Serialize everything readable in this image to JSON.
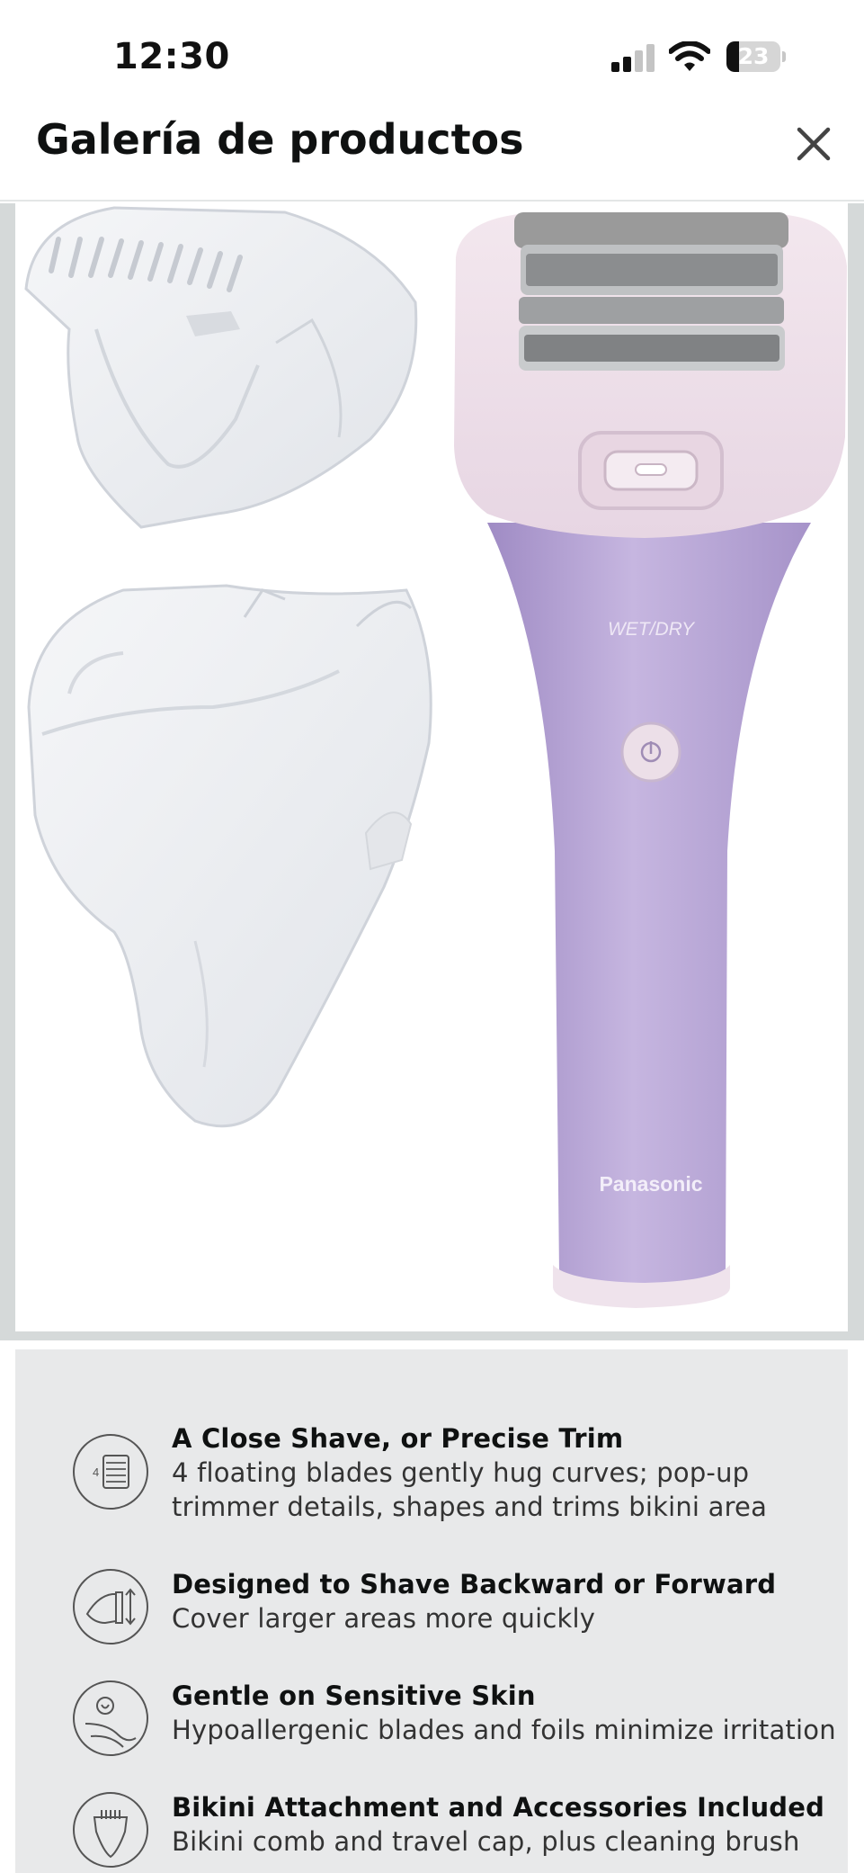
{
  "status_bar": {
    "time": "12:30",
    "battery_level": "23"
  },
  "header": {
    "title": "Galería de productos",
    "close_icon": "close-icon"
  },
  "gallery": {
    "product_brand_label": "Panasonic",
    "product_wetdry_label": "WET/DRY",
    "colors": {
      "handle": "#b7a6d4",
      "head": "#efe0ea",
      "attachment": "#eef0f3"
    }
  },
  "features": [
    {
      "icon": "four-blades-icon",
      "icon_number": "4",
      "title": "A Close Shave, or Precise Trim",
      "description_lines": [
        "4 floating blades gently hug curves; pop-up",
        "trimmer details, shapes and trims bikini area"
      ]
    },
    {
      "icon": "shave-direction-icon",
      "title": "Designed to Shave Backward or Forward",
      "description_lines": [
        "Cover larger areas more quickly"
      ]
    },
    {
      "icon": "sensitive-skin-icon",
      "title": "Gentle on Sensitive Skin",
      "description_lines": [
        "Hypoallergenic blades and foils minimize irritation"
      ]
    },
    {
      "icon": "bikini-attachment-icon",
      "title": "Bikini Attachment and Accessories Included",
      "description_lines": [
        "Bikini comb and travel cap, plus cleaning brush"
      ]
    }
  ]
}
